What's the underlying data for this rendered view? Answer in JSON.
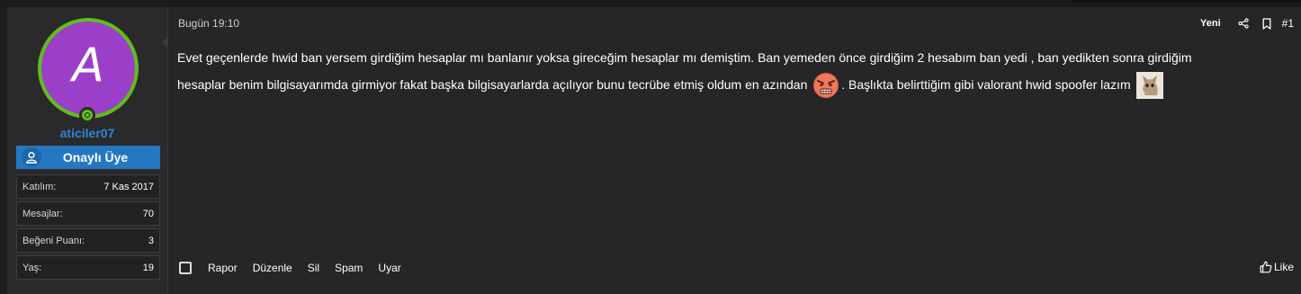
{
  "user": {
    "avatar_letter": "A",
    "username": "aticiler07",
    "rank": "Onaylı Üye",
    "stats": [
      {
        "label": "Katılım:",
        "value": "7 Kas 2017"
      },
      {
        "label": "Mesajlar:",
        "value": "70"
      },
      {
        "label": "Beğeni Puanı:",
        "value": "3"
      },
      {
        "label": "Yaş:",
        "value": "19"
      }
    ]
  },
  "post": {
    "date": "Bugün 19:10",
    "new_label": "Yeni",
    "number": "#1",
    "line1": "Evet geçenlerde hwid ban yersem girdiğim hesaplar mı banlanır yoksa gireceğim hesaplar mı demiştim. Ban yemeden önce girdiğim 2 hesabım ban yedi , ban yedikten sonra girdiğim",
    "line2a": "hesaplar benim bilgisayarımda girmiyor fakat başka bilgisayarlarda açılıyor bunu tecrübe etmiş oldum en azından",
    "line2b": ". Başlıkta belirttiğim gibi valorant hwid spoofer lazım"
  },
  "actions": {
    "report": "Rapor",
    "edit": "Düzenle",
    "delete": "Sil",
    "spam": "Spam",
    "warn": "Uyar",
    "like": "Like"
  },
  "colors": {
    "background": "#262628",
    "username": "#2f85d5",
    "rank_banner": "#2577c2",
    "avatar_bg": "#9b3fc9",
    "avatar_ring": "#5fbf1a"
  }
}
